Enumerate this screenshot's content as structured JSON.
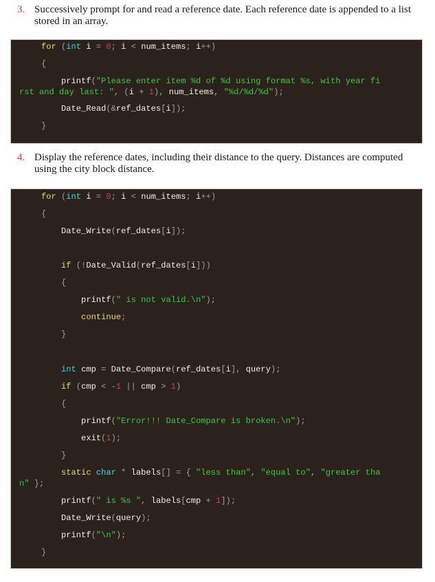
{
  "steps": [
    {
      "number": "3.",
      "text": "Successively prompt for and read a reference date. Each reference date is appended to a list stored in an array."
    },
    {
      "number": "4.",
      "text": "Display the reference dates, including their distance to the query. Distances are computed using the city block distance."
    }
  ],
  "code_blocks": [
    {
      "lines": [
        [
          {
            "t": "for",
            "c": "kw"
          },
          {
            "t": " (",
            "c": "pn"
          },
          {
            "t": "int",
            "c": "ty"
          },
          {
            "t": " i ",
            "c": "id"
          },
          {
            "t": "=",
            "c": "pn"
          },
          {
            "t": " ",
            "c": "id"
          },
          {
            "t": "0",
            "c": "num"
          },
          {
            "t": ";",
            "c": "pn"
          },
          {
            "t": " i ",
            "c": "id"
          },
          {
            "t": "<",
            "c": "pn"
          },
          {
            "t": " num_items",
            "c": "id"
          },
          {
            "t": ";",
            "c": "pn"
          },
          {
            "t": " i",
            "c": "id"
          },
          {
            "t": "++)",
            "c": "pn"
          }
        ],
        [
          {
            "t": "{",
            "c": "pn"
          }
        ],
        [
          {
            "t": "    printf",
            "c": "id"
          },
          {
            "t": "(",
            "c": "pn"
          },
          {
            "t": "\"Please enter item %d of %d using format %s, with year fi",
            "c": "str"
          }
        ],
        [
          {
            "t": "rst and day last: \"",
            "c": "str"
          },
          {
            "t": ", (",
            "c": "pn"
          },
          {
            "t": "i ",
            "c": "id"
          },
          {
            "t": "+",
            "c": "pn"
          },
          {
            "t": " ",
            "c": "id"
          },
          {
            "t": "1",
            "c": "num"
          },
          {
            "t": "), ",
            "c": "pn"
          },
          {
            "t": "num_items",
            "c": "id"
          },
          {
            "t": ", ",
            "c": "pn"
          },
          {
            "t": "\"%d/%d/%d\"",
            "c": "str"
          },
          {
            "t": ");",
            "c": "pn"
          }
        ],
        [
          {
            "t": "    Date_Read",
            "c": "id"
          },
          {
            "t": "(&",
            "c": "pn"
          },
          {
            "t": "ref_dates",
            "c": "id"
          },
          {
            "t": "[",
            "c": "pn"
          },
          {
            "t": "i",
            "c": "id"
          },
          {
            "t": "]);",
            "c": "pn"
          }
        ],
        [
          {
            "t": "}",
            "c": "pn"
          }
        ]
      ]
    },
    {
      "lines": [
        [
          {
            "t": "for",
            "c": "kw"
          },
          {
            "t": " (",
            "c": "pn"
          },
          {
            "t": "int",
            "c": "ty"
          },
          {
            "t": " i ",
            "c": "id"
          },
          {
            "t": "=",
            "c": "pn"
          },
          {
            "t": " ",
            "c": "id"
          },
          {
            "t": "0",
            "c": "num"
          },
          {
            "t": ";",
            "c": "pn"
          },
          {
            "t": " i ",
            "c": "id"
          },
          {
            "t": "<",
            "c": "pn"
          },
          {
            "t": " num_items",
            "c": "id"
          },
          {
            "t": ";",
            "c": "pn"
          },
          {
            "t": " i",
            "c": "id"
          },
          {
            "t": "++)",
            "c": "pn"
          }
        ],
        [
          {
            "t": "{",
            "c": "pn"
          }
        ],
        [
          {
            "t": "    Date_Write",
            "c": "id"
          },
          {
            "t": "(",
            "c": "pn"
          },
          {
            "t": "ref_dates",
            "c": "id"
          },
          {
            "t": "[",
            "c": "pn"
          },
          {
            "t": "i",
            "c": "id"
          },
          {
            "t": "]);",
            "c": "pn"
          }
        ],
        [
          {
            "t": "    if",
            "c": "kw"
          },
          {
            "t": " (!",
            "c": "pn"
          },
          {
            "t": "Date_Valid",
            "c": "id"
          },
          {
            "t": "(",
            "c": "pn"
          },
          {
            "t": "ref_dates",
            "c": "id"
          },
          {
            "t": "[",
            "c": "pn"
          },
          {
            "t": "i",
            "c": "id"
          },
          {
            "t": "]))",
            "c": "pn"
          }
        ],
        [
          {
            "t": "    {",
            "c": "pn"
          }
        ],
        [
          {
            "t": "        printf",
            "c": "id"
          },
          {
            "t": "(",
            "c": "pn"
          },
          {
            "t": "\" is not valid.\\n\"",
            "c": "str"
          },
          {
            "t": ");",
            "c": "pn"
          }
        ],
        [
          {
            "t": "        continue",
            "c": "kw"
          },
          {
            "t": ";",
            "c": "pn"
          }
        ],
        [
          {
            "t": "    }",
            "c": "pn"
          }
        ],
        [
          {
            "t": "    int",
            "c": "ty"
          },
          {
            "t": " cmp ",
            "c": "id"
          },
          {
            "t": "=",
            "c": "pn"
          },
          {
            "t": " Date_Compare",
            "c": "id"
          },
          {
            "t": "(",
            "c": "pn"
          },
          {
            "t": "ref_dates",
            "c": "id"
          },
          {
            "t": "[",
            "c": "pn"
          },
          {
            "t": "i",
            "c": "id"
          },
          {
            "t": "], ",
            "c": "pn"
          },
          {
            "t": "query",
            "c": "id"
          },
          {
            "t": ");",
            "c": "pn"
          }
        ],
        [
          {
            "t": "    if",
            "c": "kw"
          },
          {
            "t": " (",
            "c": "pn"
          },
          {
            "t": "cmp ",
            "c": "id"
          },
          {
            "t": "< -",
            "c": "pn"
          },
          {
            "t": "1",
            "c": "num"
          },
          {
            "t": " || ",
            "c": "pn"
          },
          {
            "t": "cmp ",
            "c": "id"
          },
          {
            "t": "> ",
            "c": "pn"
          },
          {
            "t": "1",
            "c": "num"
          },
          {
            "t": ")",
            "c": "pn"
          }
        ],
        [
          {
            "t": "    {",
            "c": "pn"
          }
        ],
        [
          {
            "t": "        printf",
            "c": "id"
          },
          {
            "t": "(",
            "c": "pn"
          },
          {
            "t": "\"Error!!! Date_Compare is broken.\\n\"",
            "c": "str"
          },
          {
            "t": ");",
            "c": "pn"
          }
        ],
        [
          {
            "t": "        exit",
            "c": "id"
          },
          {
            "t": "(",
            "c": "pn"
          },
          {
            "t": "1",
            "c": "num"
          },
          {
            "t": ");",
            "c": "pn"
          }
        ],
        [
          {
            "t": "    }",
            "c": "pn"
          }
        ],
        [
          {
            "t": "    static",
            "c": "kw"
          },
          {
            "t": " char",
            "c": "ty"
          },
          {
            "t": " * ",
            "c": "pn"
          },
          {
            "t": "labels",
            "c": "id"
          },
          {
            "t": "[] = { ",
            "c": "pn"
          },
          {
            "t": "\"less than\"",
            "c": "str"
          },
          {
            "t": ", ",
            "c": "pn"
          },
          {
            "t": "\"equal to\"",
            "c": "str"
          },
          {
            "t": ", ",
            "c": "pn"
          },
          {
            "t": "\"greater tha",
            "c": "str"
          }
        ],
        [
          {
            "t": "n\"",
            "c": "str"
          },
          {
            "t": " };",
            "c": "pn"
          }
        ],
        [
          {
            "t": "    printf",
            "c": "id"
          },
          {
            "t": "(",
            "c": "pn"
          },
          {
            "t": "\" is %s \"",
            "c": "str"
          },
          {
            "t": ", ",
            "c": "pn"
          },
          {
            "t": "labels",
            "c": "id"
          },
          {
            "t": "[",
            "c": "pn"
          },
          {
            "t": "cmp ",
            "c": "id"
          },
          {
            "t": "+ ",
            "c": "pn"
          },
          {
            "t": "1",
            "c": "num"
          },
          {
            "t": "]);",
            "c": "pn"
          }
        ],
        [
          {
            "t": "    Date_Write",
            "c": "id"
          },
          {
            "t": "(",
            "c": "pn"
          },
          {
            "t": "query",
            "c": "id"
          },
          {
            "t": ");",
            "c": "pn"
          }
        ],
        [
          {
            "t": "    printf",
            "c": "id"
          },
          {
            "t": "(",
            "c": "pn"
          },
          {
            "t": "\"\\n\"",
            "c": "str"
          },
          {
            "t": ");",
            "c": "pn"
          }
        ],
        [
          {
            "t": "}",
            "c": "pn"
          }
        ]
      ]
    }
  ]
}
